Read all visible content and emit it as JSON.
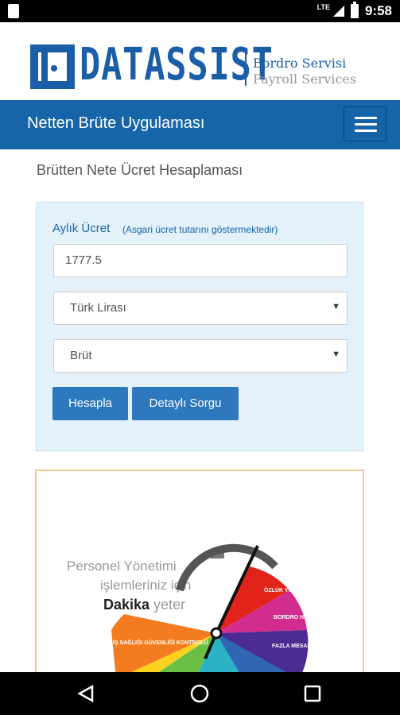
{
  "statusbar": {
    "network": "LTE",
    "time": "9:58"
  },
  "logo": {
    "word": "DATASSIST",
    "tagline1": "Bordro Servisi",
    "tagline2": "Payroll Services"
  },
  "navbar": {
    "title": "Netten Brüte Uygulaması"
  },
  "page": {
    "title": "Brütten Nete Ücret Hesaplaması"
  },
  "form": {
    "salary_label": "Aylık Ücret",
    "salary_hint": "(Asgari ücret tutarını göstermektedir)",
    "salary_value": "1777.5",
    "currency_selected": "Türk Lirası",
    "type_selected": "Brüt",
    "calculate_label": "Hesapla",
    "detailed_label": "Detaylı Sorgu"
  },
  "banner": {
    "line1": "Personel Yönetimi",
    "line2": "işlemleriniz için",
    "line3_bold": "Dakika",
    "line3_rest": " yeter",
    "segments": [
      "ÖZLÜK YÖNETİMİ",
      "BORDRO HESAPLAMA",
      "FAZLA MESAİ YÖNETİMİ",
      "İŞ SAĞLIĞI GÜVENLİĞİ KONTROLÜ"
    ]
  },
  "colors": {
    "brand": "#1a5ea8",
    "navbar": "#1565a8",
    "button": "#2e78bd",
    "panel": "#e3f1fa"
  }
}
